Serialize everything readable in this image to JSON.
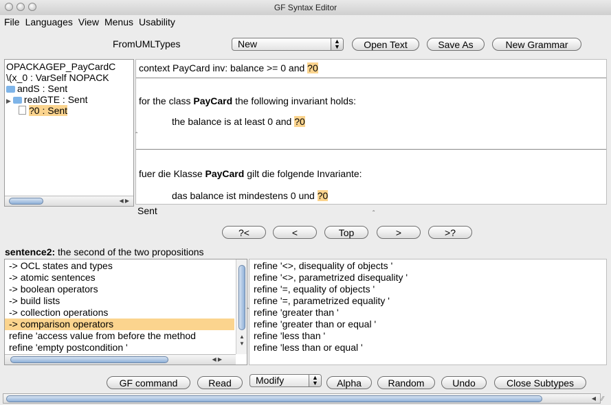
{
  "window": {
    "title": "GF Syntax Editor"
  },
  "menubar": [
    "File",
    "Languages",
    "View",
    "Menus",
    "Usability"
  ],
  "toolbar": {
    "grammar": "FromUMLTypes",
    "mode_select": "New",
    "open_text": "Open Text",
    "save_as": "Save As",
    "new_grammar": "New Grammar"
  },
  "tree": {
    "line1": "OPACKAGEP_PayCardC",
    "line2": "\\(x_0 : VarSelf NOPACK",
    "node_and": "andS : Sent",
    "node_real": "realGTE : Sent",
    "node_meta": "?0 : Sent"
  },
  "editor": {
    "ocl_text": "context PayCard inv: balance >= 0 and",
    "meta": "?0",
    "en_prefix": "for the class",
    "en_class": "PayCard",
    "en_suffix": "the following invariant holds:",
    "en_line2": "the balance is at least 0 and",
    "de_prefix": "fuer die Klasse",
    "de_class": "PayCard",
    "de_suffix": "gilt die folgende Invariante:",
    "de_line2": "das balance ist mindestens 0 und",
    "category": "Sent"
  },
  "nav": {
    "prev_meta": "?<",
    "prev": "<",
    "top": "Top",
    "next": ">",
    "next_meta": ">?"
  },
  "status": {
    "bold": "sentence2:",
    "rest": "the second of the two propositions"
  },
  "left_list": [
    "-> OCL states and types",
    "-> atomic sentences",
    "-> boolean operators",
    "-> build lists",
    "-> collection operations",
    "-> comparison operators",
    "refine 'access value from before the method",
    "refine 'empty postcondition '"
  ],
  "right_list": [
    "refine '<>, disequality of objects  '",
    "refine '<>, parametrized disequality  '",
    "refine '=, equality of objects  '",
    "refine '=, parametrized equality  '",
    "refine 'greater than '",
    "refine 'greater than or equal '",
    "refine 'less than '",
    "refine 'less than or equal '"
  ],
  "bottom": {
    "gf_command": "GF command",
    "read": "Read",
    "modify": "Modify",
    "alpha": "Alpha",
    "random": "Random",
    "undo": "Undo",
    "close_subtypes": "Close Subtypes"
  },
  "colors": {
    "highlight": "#fbd48e",
    "scroll_thumb": "#8fb0d8"
  }
}
